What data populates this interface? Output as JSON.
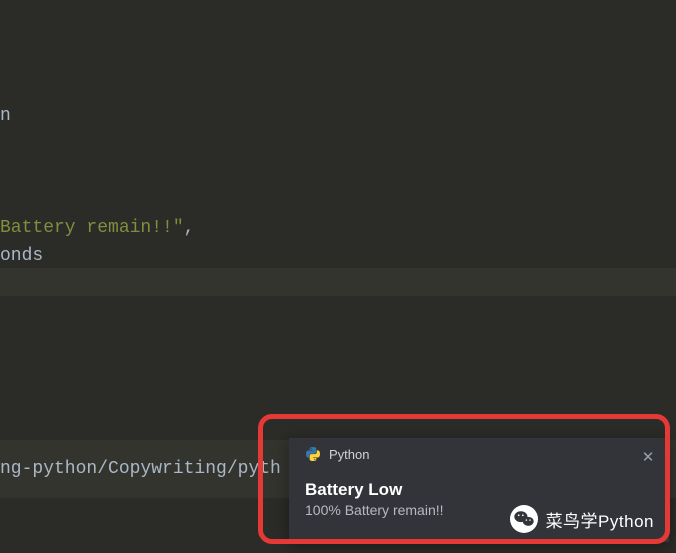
{
  "code": {
    "frag_n": "n",
    "frag_battery_string": "Battery remain!!\"",
    "frag_comma": ",",
    "frag_onds": "onds"
  },
  "console": {
    "path_fragment": "ng-python/Copywriting/pyth"
  },
  "toast": {
    "app_name": "Python",
    "title": "Battery Low",
    "message": "100% Battery remain!!",
    "close_glyph": "✕"
  },
  "watermark": {
    "text": "菜鸟学Python"
  }
}
